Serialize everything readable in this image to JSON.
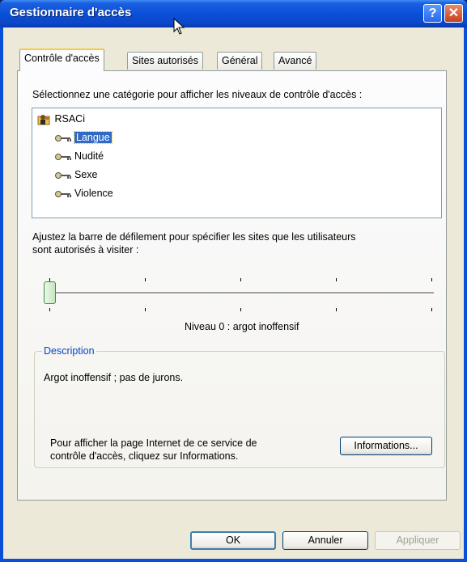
{
  "window": {
    "title": "Gestionnaire d'accès",
    "help_button": "?",
    "close_button": "✕"
  },
  "tabs": [
    {
      "label": "Contrôle d'accès",
      "active": true
    },
    {
      "label": "Sites autorisés",
      "active": false
    },
    {
      "label": "Général",
      "active": false
    },
    {
      "label": "Avancé",
      "active": false
    }
  ],
  "content": {
    "category_prompt": "Sélectionnez une catégorie pour afficher les niveaux de contrôle d'accès :",
    "tree": {
      "root": "RSACi",
      "items": [
        "Langue",
        "Nudité",
        "Sexe",
        "Violence"
      ],
      "selected": "Langue"
    },
    "slider_prompt_line1": "Ajustez la barre de défilement pour spécifier les sites que les utilisateurs",
    "slider_prompt_line2": "sont autorisés à visiter :",
    "slider_level": 0,
    "slider_max_level": 4,
    "level_text": "Niveau 0 : argot inoffensif",
    "description_legend": "Description",
    "description_text": "Argot inoffensif ; pas de jurons.",
    "info_line1": "Pour afficher la page Internet de ce service de",
    "info_line2": "contrôle d'accès, cliquez sur Informations.",
    "info_button": "Informations..."
  },
  "footer": {
    "ok": "OK",
    "cancel": "Annuler",
    "apply": "Appliquer"
  },
  "colors": {
    "titlebar": "#0a4fd8",
    "selection": "#316ac5",
    "legend": "#0046d5"
  }
}
